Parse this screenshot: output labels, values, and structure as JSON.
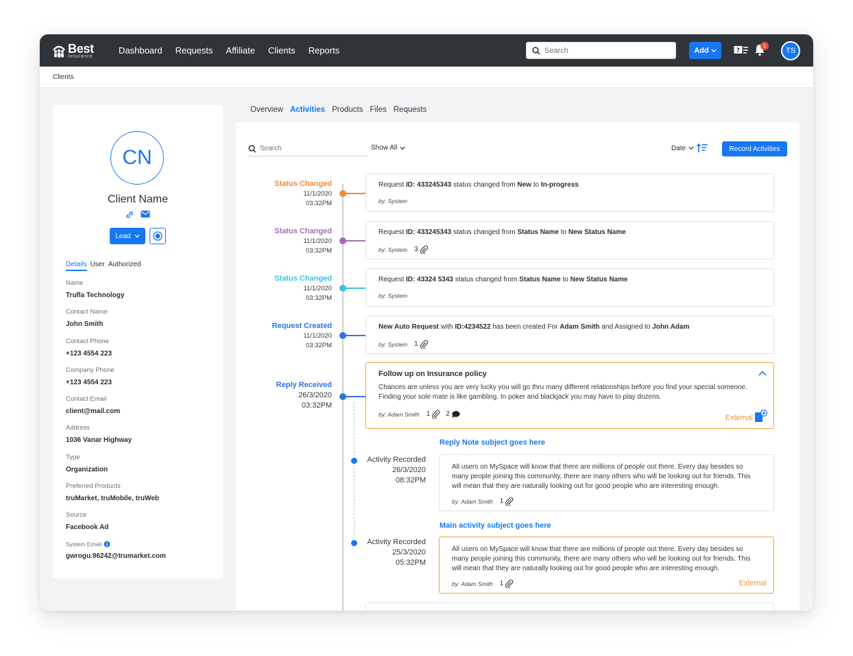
{
  "app": {
    "logo_primary": "Best",
    "logo_secondary": "Insurance"
  },
  "nav": {
    "items": [
      "Dashboard",
      "Requests",
      "Affiliate",
      "Clients",
      "Reports"
    ]
  },
  "top_search": {
    "placeholder": "Search"
  },
  "add_button": {
    "label": "Add"
  },
  "notifications": {
    "count": "1"
  },
  "user": {
    "initials": "TS"
  },
  "breadcrumb": "Clients",
  "profile": {
    "initials": "CN",
    "name": "Client Name",
    "status_button": "Lead",
    "tabs": [
      "Details",
      "User",
      "Authorized"
    ],
    "fields": [
      {
        "label": "Name",
        "value": "Trufla Technology"
      },
      {
        "label": "Contact Name",
        "value": "John Smith"
      },
      {
        "label": "Contact Phone",
        "value": "+123 4554 223"
      },
      {
        "label": "Company Phone",
        "value": "+123 4554 223"
      },
      {
        "label": "Contact Email",
        "value": "client@mail.com"
      },
      {
        "label": "Address",
        "value": "1036 Vanar Highway"
      },
      {
        "label": "Type",
        "value": "Organization"
      },
      {
        "label": "Preferred Products",
        "value": "truMarket, truMobile, truWeb"
      },
      {
        "label": "Source",
        "value": "Facebook Ad"
      },
      {
        "label": "System Email",
        "value": "gwrogu.96242@trumarket.com"
      }
    ]
  },
  "tabs": [
    "Overview",
    "Activities",
    "Products",
    "Files",
    "Requests"
  ],
  "activities": {
    "search_placeholder": "Search",
    "filter": "Show All",
    "sort": "Date",
    "record_button": "Record Activities",
    "events": [
      {
        "title": "Status Changed",
        "date": "11/1/2020",
        "time": "03:32PM",
        "color": "#f0883b",
        "msg": [
          "Request ",
          "ID: 433245343",
          " status changed from ",
          "New",
          " to ",
          "In-progress"
        ],
        "by": "by: System",
        "attach": ""
      },
      {
        "title": "Status Changed",
        "date": "11/1/2020",
        "time": "03:32PM",
        "color": "#a76bb8",
        "msg": [
          "Request ",
          "ID: 433245343",
          "  status changed from ",
          "Status Name",
          " to ",
          "New Status Name"
        ],
        "by": "by: System",
        "attach": "3"
      },
      {
        "title": "Status Changed",
        "date": "11/1/2020",
        "time": "03:32PM",
        "color": "#3fc0df",
        "msg": [
          "Request ",
          "ID: 43324 5343",
          " status changed from ",
          "Status Name",
          " to ",
          "New Status Name"
        ],
        "by": "by: System",
        "attach": ""
      },
      {
        "title": "Request Created",
        "date": "11/1/2020",
        "time": "03:32PM",
        "color": "#2f73e0",
        "msg": [
          "New Auto Request",
          " with ",
          "ID:4234522",
          " has been created For ",
          "Adam Smith",
          " and Assigned to ",
          "John Adam"
        ],
        "by": "by: System",
        "attach": "1"
      }
    ],
    "reply": {
      "title": "Reply Received",
      "date": "26/3/2020",
      "time": "03:32PM",
      "color": "#2f73e0",
      "subject": "Follow up on Insurance policy",
      "body": "Chances are unless you are very lucky you will go thru many different relationships before you find your special someone. Finding your sole mate is like gambling. In poker and blackjack you may have to play dozens.",
      "by": "by: Adam Smith",
      "attach": "1",
      "comments": "2",
      "tag": "External"
    },
    "sub_activities": [
      {
        "subject": "Reply Note subject goes here",
        "label": "Activity Recorded",
        "date": "26/3/2020",
        "time": "08:32PM",
        "body": "All users on MySpace will know that there are millions of people out there. Every day besides so many people joining this community, there are many others who will be looking out for friends. This will mean that they are naturally looking out for good people who are interesting enough.",
        "by": "by: Adam Smith",
        "attach": "1",
        "tag": ""
      },
      {
        "subject": "Main activity subject goes here",
        "label": "Activity Recorded",
        "date": "25/3/2020",
        "time": "05:32PM",
        "body": "All users on MySpace will know that there are millions of people out there. Every day besides so many people joining this community, there are many others who will be looking out for friends. This will mean that they are naturally looking out for good people who are interesting enough.",
        "by": "by: Adam Smith",
        "attach": "1",
        "tag": "External"
      }
    ]
  },
  "colors": {
    "accent": "#1877f2",
    "topbar": "#2e3438",
    "external": "#f2922c"
  }
}
